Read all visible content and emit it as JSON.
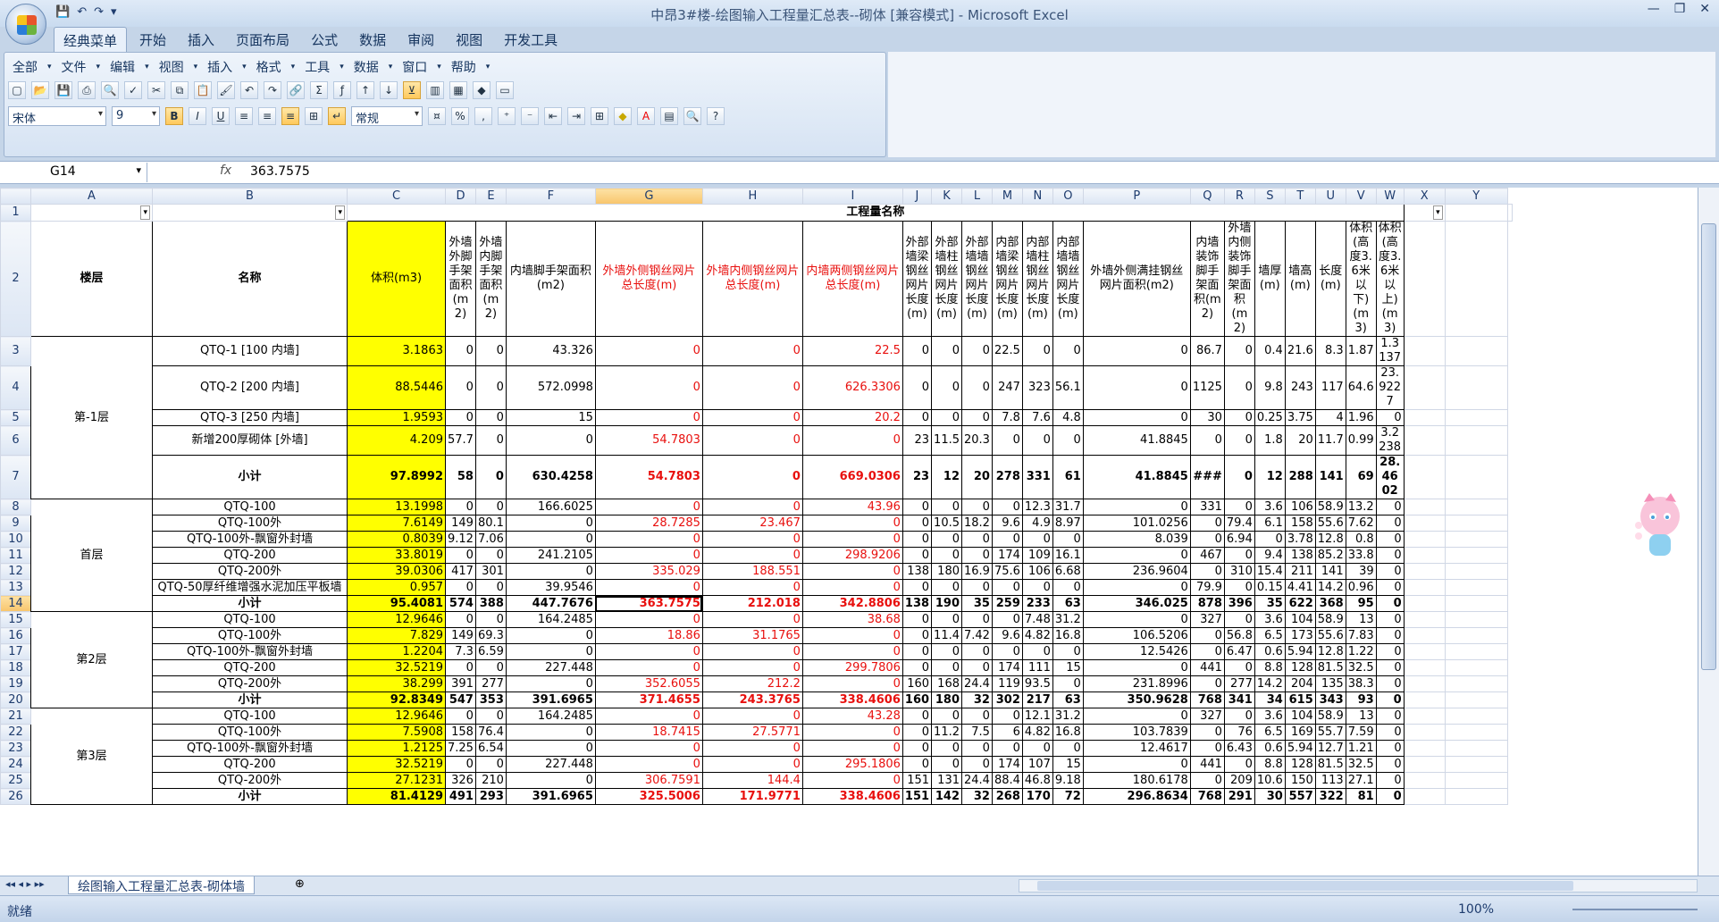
{
  "window": {
    "title": "中昂3#楼-绘图输入工程量汇总表--砌体  [兼容模式] - Microsoft Excel"
  },
  "ribbon_tabs": [
    "经典菜单",
    "开始",
    "插入",
    "页面布局",
    "公式",
    "数据",
    "审阅",
    "视图",
    "开发工具"
  ],
  "classic_menu": [
    "全部",
    "文件",
    "编辑",
    "视图",
    "插入",
    "格式",
    "工具",
    "数据",
    "窗口",
    "帮助"
  ],
  "format": {
    "font": "宋体",
    "size": "9",
    "number_format": "常规",
    "bold": "B",
    "italic": "I",
    "underline": "U",
    "percent": "%",
    "comma": ","
  },
  "formula_bar": {
    "name_box": "G14",
    "fx": "fx",
    "value": "363.7575"
  },
  "columns": [
    "A",
    "B",
    "C",
    "D",
    "E",
    "F",
    "G",
    "H",
    "I",
    "J",
    "K",
    "L",
    "M",
    "N",
    "O",
    "P",
    "Q",
    "R",
    "S",
    "T",
    "U",
    "V",
    "W",
    "X",
    "Y"
  ],
  "selected_column": "G",
  "selected_row": "14",
  "header": {
    "group_title": "工程量名称",
    "floor": "楼层",
    "name": "名称",
    "labels": [
      "体积(m3)",
      "外墙外脚手架面积(m2)",
      "外墙内脚手架面积(m2)",
      "内墙脚手架面积(m2)",
      "外墙外侧钢丝网片总长度(m)",
      "外墙内侧钢丝网片总长度(m)",
      "内墙两侧钢丝网片总长度(m)",
      "外部墙梁钢丝网片长度(m)",
      "外部墙柱钢丝网片长度(m)",
      "外部墙墙钢丝网片长度(m)",
      "内部墙梁钢丝网片长度(m)",
      "内部墙柱钢丝网片长度(m)",
      "内部墙墙钢丝网片长度(m)",
      "外墙外侧满挂钢丝网片面积(m2)",
      "内墙装饰脚手架面积(m2)",
      "外墙内侧装饰脚手架面积(m2)",
      "墙厚(m)",
      "墙高(m)",
      "长度(m)",
      "体积(高度3.6米以下)(m3)",
      "体积(高度3.6米以上)(m3)"
    ]
  },
  "groups": [
    {
      "floor": "第-1层",
      "rows": [
        {
          "n": "3",
          "name": "QTQ-1 [100 内墙]",
          "v": [
            "3.1863",
            "0",
            "0",
            "43.326",
            "0",
            "0",
            "22.5",
            "0",
            "0",
            "0",
            "22.5",
            "0",
            "0",
            "0",
            "86.7",
            "0",
            "0.4",
            "21.6",
            "8.3",
            "1.87",
            "1.3137"
          ]
        },
        {
          "n": "4",
          "name": "QTQ-2 [200 内墙]",
          "v": [
            "88.5446",
            "0",
            "0",
            "572.0998",
            "0",
            "0",
            "626.3306",
            "0",
            "0",
            "0",
            "247",
            "323",
            "56.1",
            "0",
            "1125",
            "0",
            "9.8",
            "243",
            "117",
            "64.6",
            "23.9227"
          ]
        },
        {
          "n": "5",
          "name": "QTQ-3 [250 内墙]",
          "v": [
            "1.9593",
            "0",
            "0",
            "15",
            "0",
            "0",
            "20.2",
            "0",
            "0",
            "0",
            "7.8",
            "7.6",
            "4.8",
            "0",
            "30",
            "0",
            "0.25",
            "3.75",
            "4",
            "1.96",
            "0"
          ]
        },
        {
          "n": "6",
          "name": "新增200厚砌体 [外墙]",
          "v": [
            "4.209",
            "57.7",
            "0",
            "0",
            "54.7803",
            "0",
            "0",
            "23",
            "11.5",
            "20.3",
            "0",
            "0",
            "0",
            "41.8845",
            "0",
            "0",
            "1.8",
            "20",
            "11.7",
            "0.99",
            "3.2238"
          ]
        },
        {
          "n": "7",
          "name": "小计",
          "sub": true,
          "v": [
            "97.8992",
            "58",
            "0",
            "630.4258",
            "54.7803",
            "0",
            "669.0306",
            "23",
            "12",
            "20",
            "278",
            "331",
            "61",
            "41.8845",
            "###",
            "0",
            "12",
            "288",
            "141",
            "69",
            "28.4602"
          ]
        }
      ]
    },
    {
      "floor": "首层",
      "rows": [
        {
          "n": "8",
          "name": "QTQ-100",
          "v": [
            "13.1998",
            "0",
            "0",
            "166.6025",
            "0",
            "0",
            "43.96",
            "0",
            "0",
            "0",
            "0",
            "12.3",
            "31.7",
            "0",
            "331",
            "0",
            "3.6",
            "106",
            "58.9",
            "13.2",
            "0"
          ]
        },
        {
          "n": "9",
          "name": "QTQ-100外",
          "v": [
            "7.6149",
            "149",
            "80.1",
            "0",
            "28.7285",
            "23.467",
            "0",
            "0",
            "10.5",
            "18.2",
            "9.6",
            "4.9",
            "8.97",
            "101.0256",
            "0",
            "79.4",
            "6.1",
            "158",
            "55.6",
            "7.62",
            "0"
          ]
        },
        {
          "n": "10",
          "name": "QTQ-100外-飘窗外封墙",
          "v": [
            "0.8039",
            "9.12",
            "7.06",
            "0",
            "0",
            "0",
            "0",
            "0",
            "0",
            "0",
            "0",
            "0",
            "0",
            "8.039",
            "0",
            "6.94",
            "0",
            "3.78",
            "12.8",
            "0.8",
            "0"
          ]
        },
        {
          "n": "11",
          "name": "QTQ-200",
          "v": [
            "33.8019",
            "0",
            "0",
            "241.2105",
            "0",
            "0",
            "298.9206",
            "0",
            "0",
            "0",
            "174",
            "109",
            "16.1",
            "0",
            "467",
            "0",
            "9.4",
            "138",
            "85.2",
            "33.8",
            "0"
          ]
        },
        {
          "n": "12",
          "name": "QTQ-200外",
          "v": [
            "39.0306",
            "417",
            "301",
            "0",
            "335.029",
            "188.551",
            "0",
            "138",
            "180",
            "16.9",
            "75.6",
            "106",
            "6.68",
            "236.9604",
            "0",
            "310",
            "15.4",
            "211",
            "141",
            "39",
            "0"
          ]
        },
        {
          "n": "13",
          "name": "QTQ-50厚纤维增强水泥加压平板墙",
          "v": [
            "0.957",
            "0",
            "0",
            "39.9546",
            "0",
            "0",
            "0",
            "0",
            "0",
            "0",
            "0",
            "0",
            "0",
            "0",
            "79.9",
            "0",
            "0.15",
            "4.41",
            "14.2",
            "0.96",
            "0"
          ]
        },
        {
          "n": "14",
          "name": "小计",
          "sub": true,
          "v": [
            "95.4081",
            "574",
            "388",
            "447.7676",
            "363.7575",
            "212.018",
            "342.8806",
            "138",
            "190",
            "35",
            "259",
            "233",
            "63",
            "346.025",
            "878",
            "396",
            "35",
            "622",
            "368",
            "95",
            "0"
          ]
        }
      ]
    },
    {
      "floor": "第2层",
      "rows": [
        {
          "n": "15",
          "name": "QTQ-100",
          "v": [
            "12.9646",
            "0",
            "0",
            "164.2485",
            "0",
            "0",
            "38.68",
            "0",
            "0",
            "0",
            "0",
            "7.48",
            "31.2",
            "0",
            "327",
            "0",
            "3.6",
            "104",
            "58.9",
            "13",
            "0"
          ]
        },
        {
          "n": "16",
          "name": "QTQ-100外",
          "v": [
            "7.829",
            "149",
            "69.3",
            "0",
            "18.86",
            "31.1765",
            "0",
            "0",
            "11.4",
            "7.42",
            "9.6",
            "4.82",
            "16.8",
            "106.5206",
            "0",
            "56.8",
            "6.5",
            "173",
            "55.6",
            "7.83",
            "0"
          ]
        },
        {
          "n": "17",
          "name": "QTQ-100外-飘窗外封墙",
          "v": [
            "1.2204",
            "7.3",
            "6.59",
            "0",
            "0",
            "0",
            "0",
            "0",
            "0",
            "0",
            "0",
            "0",
            "0",
            "12.5426",
            "0",
            "6.47",
            "0.6",
            "5.94",
            "12.8",
            "1.22",
            "0"
          ]
        },
        {
          "n": "18",
          "name": "QTQ-200",
          "v": [
            "32.5219",
            "0",
            "0",
            "227.448",
            "0",
            "0",
            "299.7806",
            "0",
            "0",
            "0",
            "174",
            "111",
            "15",
            "0",
            "441",
            "0",
            "8.8",
            "128",
            "81.5",
            "32.5",
            "0"
          ]
        },
        {
          "n": "19",
          "name": "QTQ-200外",
          "v": [
            "38.299",
            "391",
            "277",
            "0",
            "352.6055",
            "212.2",
            "0",
            "160",
            "168",
            "24.4",
            "119",
            "93.5",
            "0",
            "231.8996",
            "0",
            "277",
            "14.2",
            "204",
            "135",
            "38.3",
            "0"
          ]
        },
        {
          "n": "20",
          "name": "小计",
          "sub": true,
          "v": [
            "92.8349",
            "547",
            "353",
            "391.6965",
            "371.4655",
            "243.3765",
            "338.4606",
            "160",
            "180",
            "32",
            "302",
            "217",
            "63",
            "350.9628",
            "768",
            "341",
            "34",
            "615",
            "343",
            "93",
            "0"
          ]
        }
      ]
    },
    {
      "floor": "第3层",
      "rows": [
        {
          "n": "21",
          "name": "QTQ-100",
          "v": [
            "12.9646",
            "0",
            "0",
            "164.2485",
            "0",
            "0",
            "43.28",
            "0",
            "0",
            "0",
            "0",
            "12.1",
            "31.2",
            "0",
            "327",
            "0",
            "3.6",
            "104",
            "58.9",
            "13",
            "0"
          ]
        },
        {
          "n": "22",
          "name": "QTQ-100外",
          "v": [
            "7.5908",
            "158",
            "76.4",
            "0",
            "18.7415",
            "27.5771",
            "0",
            "0",
            "11.2",
            "7.5",
            "6",
            "4.82",
            "16.8",
            "103.7839",
            "0",
            "76",
            "6.5",
            "169",
            "55.7",
            "7.59",
            "0"
          ]
        },
        {
          "n": "23",
          "name": "QTQ-100外-飘窗外封墙",
          "v": [
            "1.2125",
            "7.25",
            "6.54",
            "0",
            "0",
            "0",
            "0",
            "0",
            "0",
            "0",
            "0",
            "0",
            "0",
            "12.4617",
            "0",
            "6.43",
            "0.6",
            "5.94",
            "12.7",
            "1.21",
            "0"
          ]
        },
        {
          "n": "24",
          "name": "QTQ-200",
          "v": [
            "32.5219",
            "0",
            "0",
            "227.448",
            "0",
            "0",
            "295.1806",
            "0",
            "0",
            "0",
            "174",
            "107",
            "15",
            "0",
            "441",
            "0",
            "8.8",
            "128",
            "81.5",
            "32.5",
            "0"
          ]
        },
        {
          "n": "25",
          "name": "QTQ-200外",
          "v": [
            "27.1231",
            "326",
            "210",
            "0",
            "306.7591",
            "144.4",
            "0",
            "151",
            "131",
            "24.4",
            "88.4",
            "46.8",
            "9.18",
            "180.6178",
            "0",
            "209",
            "10.6",
            "150",
            "113",
            "27.1",
            "0"
          ]
        },
        {
          "n": "26",
          "name": "小计",
          "sub": true,
          "v": [
            "81.4129",
            "491",
            "293",
            "391.6965",
            "325.5006",
            "171.9771",
            "338.4606",
            "151",
            "142",
            "32",
            "268",
            "170",
            "72",
            "296.8634",
            "768",
            "291",
            "30",
            "557",
            "322",
            "81",
            "0"
          ]
        }
      ]
    }
  ],
  "sheet_tab": "绘图输入工程量汇总表-砌体墙",
  "status": {
    "ready": "就绪",
    "zoom": "100%"
  }
}
